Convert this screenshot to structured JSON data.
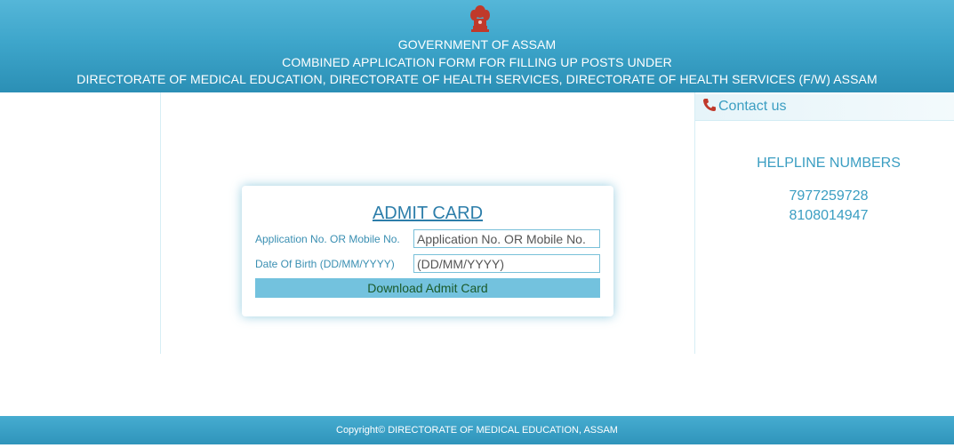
{
  "header": {
    "line1": "GOVERNMENT OF ASSAM",
    "line2": "COMBINED APPLICATION FORM FOR FILLING UP POSTS UNDER",
    "line3": "DIRECTORATE OF MEDICAL EDUCATION, DIRECTORATE OF HEALTH SERVICES, DIRECTORATE OF HEALTH SERVICES (F/W) ASSAM",
    "emblem_icon": "national-emblem-icon"
  },
  "contact": {
    "title": "Contact us",
    "icon": "phone-icon",
    "helpline_title": "HELPLINE NUMBERS",
    "numbers": [
      "7977259728",
      "8108014947"
    ]
  },
  "admit_card": {
    "title": "ADMIT CARD",
    "app_label": "Application No. OR Mobile No.",
    "app_placeholder": "Application No. OR Mobile No.",
    "dob_label": "Date Of Birth (DD/MM/YYYY)",
    "dob_placeholder": "(DD/MM/YYYY)",
    "submit_label": "Download Admit Card"
  },
  "footer": {
    "copyright": "Copyright© DIRECTORATE OF MEDICAL EDUCATION, ASSAM"
  },
  "colors": {
    "header_blue": "#3ea6cb",
    "accent_text": "#3b9ec2",
    "button_bg": "#73c2de",
    "emblem_red": "#c0392b"
  }
}
